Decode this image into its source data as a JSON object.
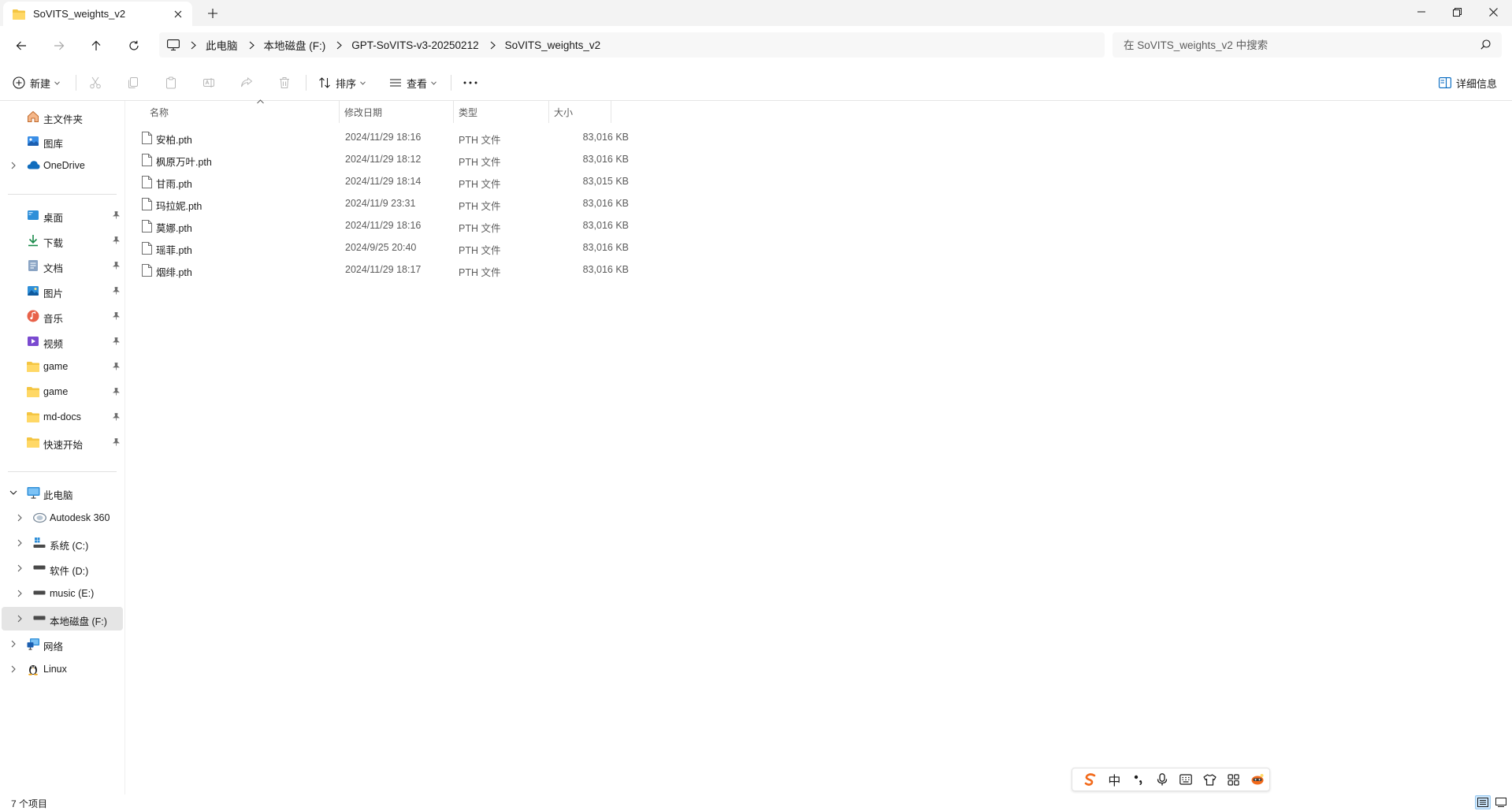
{
  "window": {
    "tab_title": "SoVITS_weights_v2"
  },
  "breadcrumb": [
    "此电脑",
    "本地磁盘 (F:)",
    "GPT-SoVITS-v3-20250212",
    "SoVITS_weights_v2"
  ],
  "search": {
    "placeholder": "在 SoVITS_weights_v2 中搜索",
    "value": ""
  },
  "commands": {
    "new_label": "新建",
    "sort_label": "排序",
    "view_label": "查看",
    "details_label": "详细信息"
  },
  "sidebar": {
    "quick": [
      {
        "label": "主文件夹",
        "icon": "home-icon"
      },
      {
        "label": "图库",
        "icon": "gallery-icon"
      },
      {
        "label": "OneDrive",
        "icon": "cloud-icon"
      }
    ],
    "pinned": [
      {
        "label": "桌面",
        "icon": "desktop-icon"
      },
      {
        "label": "下载",
        "icon": "download-icon"
      },
      {
        "label": "文档",
        "icon": "document-icon"
      },
      {
        "label": "图片",
        "icon": "picture-icon"
      },
      {
        "label": "音乐",
        "icon": "music-icon"
      },
      {
        "label": "视频",
        "icon": "video-icon"
      },
      {
        "label": "game",
        "icon": "folder-icon"
      },
      {
        "label": "game",
        "icon": "folder-icon"
      },
      {
        "label": "md-docs",
        "icon": "folder-icon"
      },
      {
        "label": "快速开始",
        "icon": "folder-icon"
      }
    ],
    "this_pc": {
      "label": "此电脑",
      "icon": "pc-icon"
    },
    "drives": [
      {
        "label": "Autodesk 360",
        "icon": "autodesk-icon"
      },
      {
        "label": "系统 (C:)",
        "icon": "system-drive-icon"
      },
      {
        "label": "软件 (D:)",
        "icon": "drive-icon"
      },
      {
        "label": "music (E:)",
        "icon": "drive-icon"
      },
      {
        "label": "本地磁盘 (F:)",
        "icon": "drive-icon",
        "selected": true
      }
    ],
    "network": {
      "label": "网络",
      "icon": "network-icon"
    },
    "linux": {
      "label": "Linux",
      "icon": "linux-icon"
    }
  },
  "columns": {
    "name": "名称",
    "date": "修改日期",
    "type": "类型",
    "size": "大小"
  },
  "files": [
    {
      "name": "安柏.pth",
      "date": "2024/11/29 18:16",
      "type": "PTH 文件",
      "size": "83,016 KB"
    },
    {
      "name": "枫原万叶.pth",
      "date": "2024/11/29 18:12",
      "type": "PTH 文件",
      "size": "83,016 KB"
    },
    {
      "name": "甘雨.pth",
      "date": "2024/11/29 18:14",
      "type": "PTH 文件",
      "size": "83,015 KB"
    },
    {
      "name": "玛拉妮.pth",
      "date": "2024/11/9 23:31",
      "type": "PTH 文件",
      "size": "83,016 KB"
    },
    {
      "name": "莫娜.pth",
      "date": "2024/11/29 18:16",
      "type": "PTH 文件",
      "size": "83,016 KB"
    },
    {
      "name": "瑶菲.pth",
      "date": "2024/9/25 20:40",
      "type": "PTH 文件",
      "size": "83,016 KB"
    },
    {
      "name": "烟绯.pth",
      "date": "2024/11/29 18:17",
      "type": "PTH 文件",
      "size": "83,016 KB"
    }
  ],
  "status": {
    "item_count": "7 个项目"
  },
  "ime": {
    "mode_label": "中"
  },
  "colors": {
    "folder": "#f4c542",
    "accent": "#0067c0",
    "selected_bg": "#e5e5e5",
    "sogou_orange": "#f26a1b"
  }
}
